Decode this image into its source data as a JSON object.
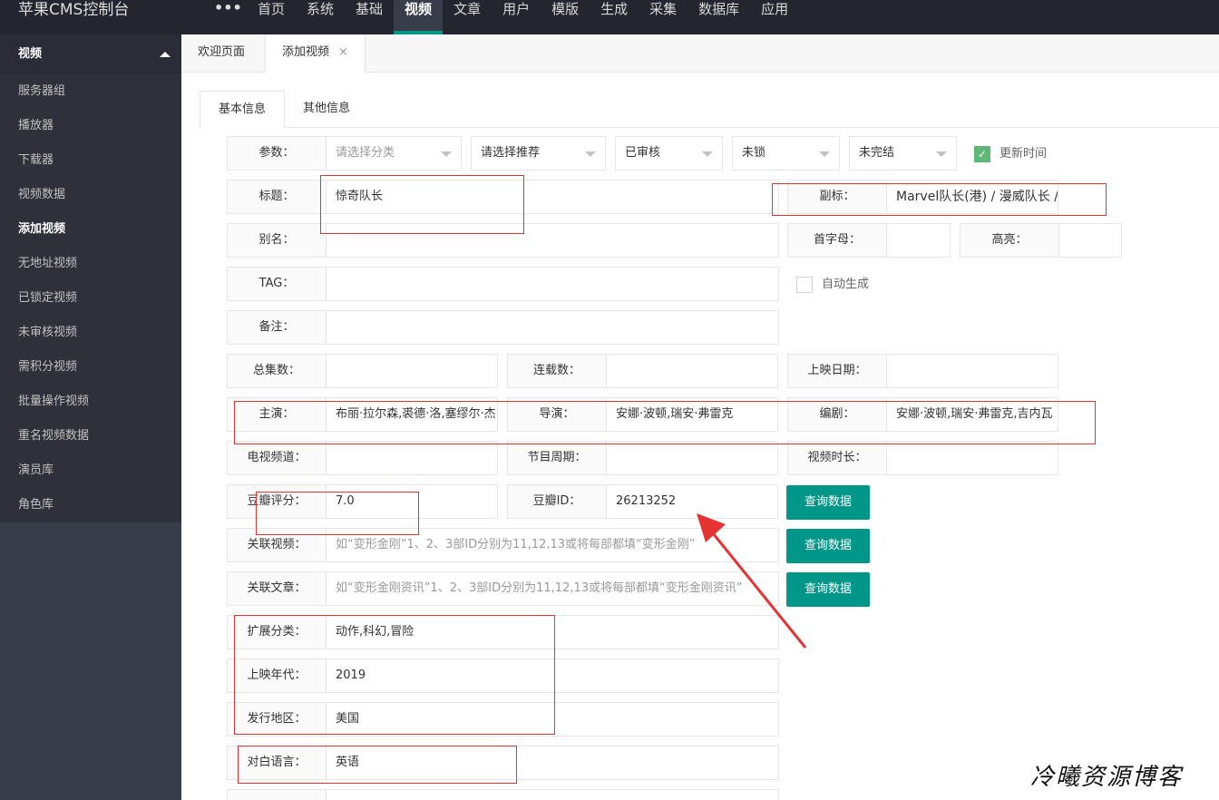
{
  "app": {
    "title": "苹果CMS控制台",
    "more": "•••"
  },
  "topnav": [
    "首页",
    "系统",
    "基础",
    "视频",
    "文章",
    "用户",
    "模版",
    "生成",
    "采集",
    "数据库",
    "应用"
  ],
  "sidebar": {
    "header": "视频",
    "items": [
      "服务器组",
      "播放器",
      "下载器",
      "视频数据",
      "添加视频",
      "无地址视频",
      "已锁定视频",
      "未审核视频",
      "需积分视频",
      "批量操作视频",
      "重名视频数据",
      "演员库",
      "角色库"
    ]
  },
  "pagetabs": {
    "welcome": "欢迎页面",
    "add": "添加视频",
    "close": "×"
  },
  "content_tabs": {
    "basic": "基本信息",
    "other": "其他信息"
  },
  "form": {
    "params_label": "参数：",
    "category_placeholder": "请选择分类",
    "recommend": "请选择推荐",
    "status": "已审核",
    "lock": "未锁",
    "finish": "未完结",
    "update_time_label": "更新时间",
    "title_label": "标题：",
    "title_value": "惊奇队长",
    "subtitle_label": "副标：",
    "subtitle_value": "Marvel队长(港) / 漫威队长 /",
    "alias_label": "别名：",
    "initial_label": "首字母：",
    "highlight_label": "高亮：",
    "tag_label": "TAG：",
    "auto_gen_label": "自动生成",
    "remark_label": "备注：",
    "total_label": "总集数：",
    "serial_label": "连载数：",
    "release_date_label": "上映日期：",
    "actor_label": "主演：",
    "actor_value": "布丽·拉尔森,裘德·洛,塞缪尔·杰",
    "director_label": "导演：",
    "director_value": "安娜·波顿,瑞安·弗雷克",
    "writer_label": "编剧：",
    "writer_value": "安娜·波顿,瑞安·弗雷克,吉内瓦",
    "tv_label": "电视频道：",
    "period_label": "节目周期：",
    "duration_label": "视频时长：",
    "douban_score_label": "豆瓣评分：",
    "douban_score_value": "7.0",
    "douban_id_label": "豆瓣ID：",
    "douban_id_value": "26213252",
    "query_button": "查询数据",
    "rel_video_label": "关联视频：",
    "rel_video_placeholder": "如“变形金刚”1、2、3部ID分别为11,12,13或将每部都填“变形金刚”",
    "rel_article_label": "关联文章：",
    "rel_article_placeholder": "如“变形金刚资讯”1、2、3部ID分别为11,12,13或将每部都填“变形金刚资讯”",
    "ext_class_label": "扩展分类：",
    "ext_class_value": "动作,科幻,冒险",
    "year_label": "上映年代：",
    "year_value": "2019",
    "area_label": "发行地区：",
    "area_value": "美国",
    "lang_label": "对白语言：",
    "lang_value": "英语"
  },
  "watermark": "冷曦资源博客",
  "colors": {
    "accent": "#009688",
    "topbar": "#23262e",
    "sidebar": "#393d49",
    "annotation": "#e53333",
    "checkbox": "#5fb878"
  }
}
